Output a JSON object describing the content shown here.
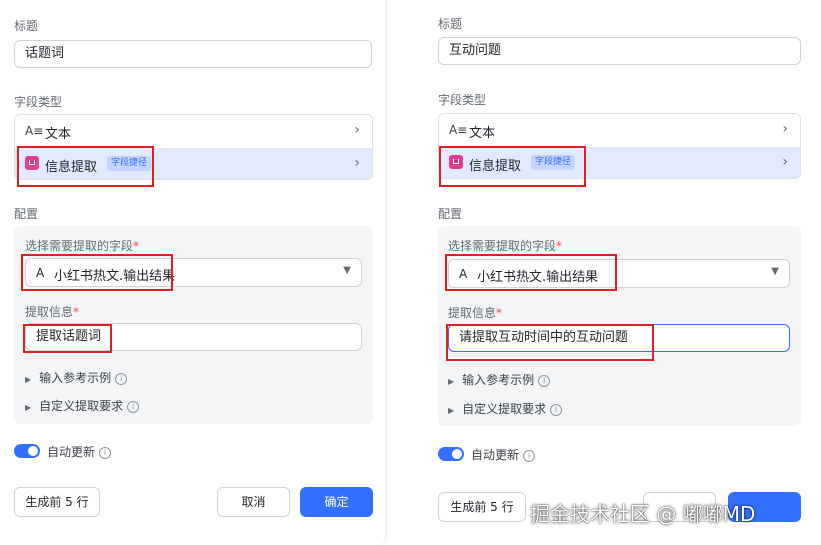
{
  "left": {
    "title_label": "标题",
    "title_value": "话题词",
    "field_type_label": "字段类型",
    "type_text_icon": "A≡",
    "type_text_label": "文本",
    "type_extract_label": "信息提取",
    "type_extract_badge": "字段捷径",
    "config_label": "配置",
    "select_field_label": "选择需要提取的字段",
    "required_mark": "*",
    "select_field_icon": "A",
    "select_field_value": "小红书热文.输出结果",
    "extract_info_label": "提取信息",
    "extract_info_value": "提取话题词",
    "expander_reference": "输入参考示例",
    "expander_custom": "自定义提取要求",
    "auto_update_label": "自动更新",
    "generate_button": "生成前 5 行",
    "cancel_button": "取消",
    "confirm_button": "确定"
  },
  "right": {
    "title_label": "标题",
    "title_value": "互动问题",
    "field_type_label": "字段类型",
    "type_text_icon": "A≡",
    "type_text_label": "文本",
    "type_extract_label": "信息提取",
    "type_extract_badge": "字段捷径",
    "config_label": "配置",
    "select_field_label": "选择需要提取的字段",
    "required_mark": "*",
    "select_field_icon": "A",
    "select_field_value": "小红书热文.输出结果",
    "extract_info_label": "提取信息",
    "extract_info_value": "请提取互动时间中的互动问题",
    "expander_reference": "输入参考示例",
    "expander_custom": "自定义提取要求",
    "auto_update_label": "自动更新",
    "generate_button": "生成前 5 行"
  },
  "watermark": "掘金技术社区 @ 嘟嘟MD",
  "colors": {
    "accent": "#3370ff",
    "highlight": "#e02020",
    "selected_row": "#e1eaff"
  }
}
